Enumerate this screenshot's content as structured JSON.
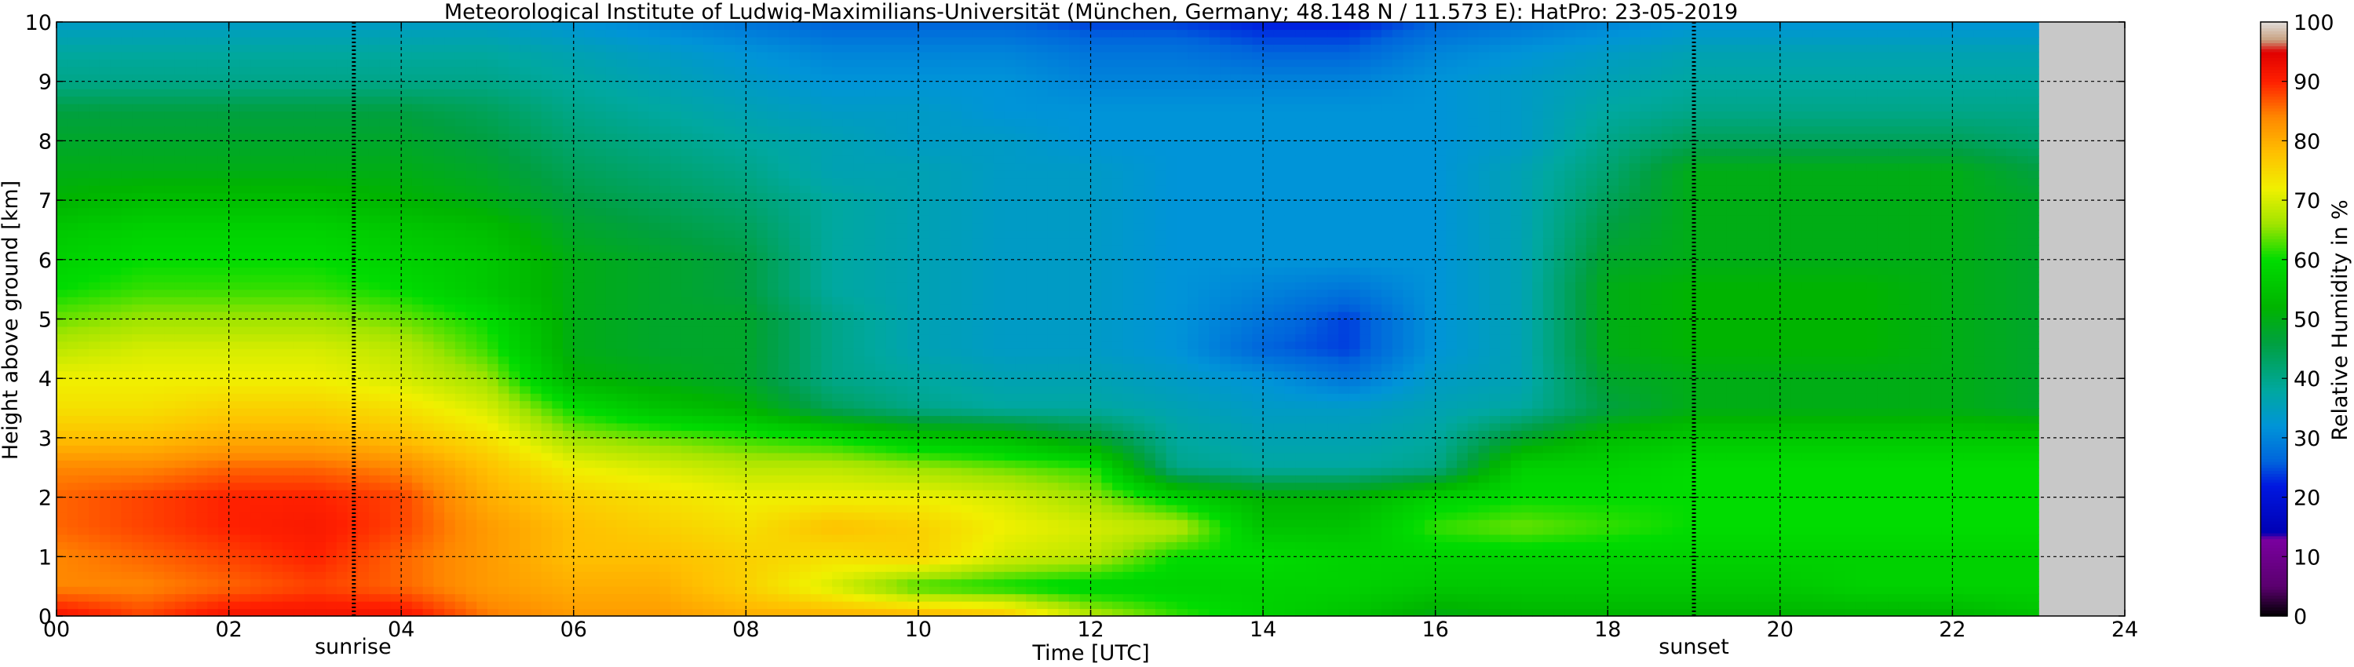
{
  "chart_data": {
    "type": "heatmap",
    "title": "Meteorological Institute of Ludwig-Maximilians-Universität (München, Germany; 48.148 N / 11.573 E):    HatPro: 23-05-2019",
    "xlabel": "Time [UTC]",
    "ylabel": "Height above ground [km]",
    "colorbar_label": "Relative Humidity in %",
    "xlim": [
      0,
      24
    ],
    "ylim": [
      0,
      10
    ],
    "xticks": [
      "00",
      "02",
      "04",
      "06",
      "08",
      "10",
      "12",
      "14",
      "16",
      "18",
      "20",
      "22",
      "24"
    ],
    "yticks": [
      "0",
      "1",
      "2",
      "3",
      "4",
      "5",
      "6",
      "7",
      "8",
      "9",
      "10"
    ],
    "colorbar_ticks": [
      "0",
      "10",
      "20",
      "30",
      "40",
      "50",
      "60",
      "70",
      "80",
      "90",
      "100"
    ],
    "colorbar_range": [
      0,
      100
    ],
    "grid": true,
    "data_end_hour": 23.0,
    "no_data_color": "#c8c8c8",
    "markers": [
      {
        "label": "sunrise",
        "hour": 3.45
      },
      {
        "label": "sunset",
        "hour": 19.0
      }
    ],
    "colormap": [
      {
        "v": 0,
        "color": "#000000"
      },
      {
        "v": 5,
        "color": "#5a006e"
      },
      {
        "v": 13,
        "color": "#7a00a0"
      },
      {
        "v": 14,
        "color": "#0000b4"
      },
      {
        "v": 22,
        "color": "#0018e0"
      },
      {
        "v": 26,
        "color": "#0064dc"
      },
      {
        "v": 32,
        "color": "#0094d8"
      },
      {
        "v": 38,
        "color": "#00a8a0"
      },
      {
        "v": 46,
        "color": "#00a040"
      },
      {
        "v": 52,
        "color": "#00b400"
      },
      {
        "v": 60,
        "color": "#00dc00"
      },
      {
        "v": 66,
        "color": "#a0e400"
      },
      {
        "v": 72,
        "color": "#f0f000"
      },
      {
        "v": 78,
        "color": "#ffc000"
      },
      {
        "v": 84,
        "color": "#ff8800"
      },
      {
        "v": 90,
        "color": "#ff2000"
      },
      {
        "v": 95,
        "color": "#e00000"
      },
      {
        "v": 97,
        "color": "#c8a080"
      },
      {
        "v": 100,
        "color": "#e0dcd8"
      }
    ],
    "times_hours": [
      0,
      1,
      2,
      3,
      4,
      5,
      6,
      7,
      8,
      9,
      10,
      11,
      12,
      13,
      14,
      15,
      16,
      17,
      18,
      19,
      20,
      21,
      22,
      23
    ],
    "heights_km": [
      0,
      0.5,
      1,
      1.5,
      2,
      2.5,
      3,
      3.5,
      4,
      4.5,
      5,
      5.5,
      6,
      6.5,
      7,
      7.5,
      8,
      8.5,
      9,
      9.5,
      10
    ],
    "rh_percent": [
      [
        92,
        88,
        92,
        92,
        92,
        85,
        82,
        82,
        80,
        80,
        80,
        78,
        68,
        62,
        58,
        55,
        50,
        52,
        52,
        52,
        52,
        52,
        52,
        55
      ],
      [
        84,
        84,
        86,
        88,
        86,
        82,
        80,
        80,
        76,
        70,
        62,
        60,
        58,
        58,
        58,
        58,
        56,
        56,
        56,
        56,
        56,
        58,
        58,
        58
      ],
      [
        84,
        86,
        88,
        90,
        86,
        82,
        78,
        78,
        76,
        74,
        76,
        70,
        68,
        60,
        60,
        58,
        58,
        58,
        58,
        58,
        58,
        58,
        58,
        58
      ],
      [
        86,
        88,
        90,
        91,
        88,
        82,
        78,
        76,
        74,
        78,
        76,
        72,
        70,
        68,
        55,
        55,
        62,
        64,
        62,
        60,
        60,
        60,
        60,
        60
      ],
      [
        86,
        88,
        90,
        90,
        88,
        80,
        76,
        74,
        72,
        72,
        72,
        70,
        66,
        58,
        52,
        52,
        58,
        60,
        60,
        60,
        60,
        60,
        60,
        60
      ],
      [
        84,
        84,
        86,
        86,
        84,
        78,
        72,
        70,
        68,
        68,
        66,
        64,
        62,
        40,
        38,
        38,
        40,
        58,
        58,
        60,
        60,
        60,
        60,
        60
      ],
      [
        78,
        78,
        80,
        80,
        78,
        74,
        66,
        64,
        62,
        60,
        56,
        54,
        48,
        38,
        36,
        36,
        38,
        48,
        54,
        56,
        56,
        56,
        56,
        56
      ],
      [
        74,
        74,
        76,
        76,
        74,
        70,
        60,
        55,
        52,
        44,
        40,
        38,
        38,
        36,
        34,
        34,
        36,
        38,
        46,
        50,
        50,
        50,
        50,
        48
      ],
      [
        72,
        72,
        72,
        72,
        70,
        66,
        52,
        50,
        48,
        40,
        38,
        36,
        36,
        34,
        32,
        28,
        34,
        36,
        48,
        50,
        50,
        50,
        50,
        48
      ],
      [
        68,
        70,
        70,
        70,
        68,
        62,
        50,
        48,
        48,
        40,
        36,
        34,
        34,
        32,
        26,
        24,
        32,
        36,
        50,
        52,
        52,
        52,
        50,
        48
      ],
      [
        64,
        66,
        66,
        66,
        64,
        60,
        50,
        48,
        48,
        40,
        36,
        34,
        34,
        32,
        28,
        24,
        32,
        36,
        50,
        52,
        52,
        52,
        50,
        48
      ],
      [
        60,
        62,
        62,
        62,
        60,
        56,
        50,
        48,
        46,
        38,
        36,
        34,
        34,
        32,
        30,
        28,
        32,
        36,
        50,
        52,
        52,
        52,
        50,
        48
      ],
      [
        58,
        60,
        60,
        60,
        58,
        56,
        50,
        48,
        46,
        38,
        36,
        34,
        34,
        32,
        32,
        32,
        32,
        36,
        48,
        50,
        50,
        50,
        50,
        48
      ],
      [
        56,
        58,
        58,
        58,
        56,
        54,
        48,
        46,
        44,
        38,
        36,
        34,
        34,
        32,
        32,
        32,
        32,
        36,
        46,
        50,
        50,
        50,
        50,
        48
      ],
      [
        52,
        54,
        54,
        54,
        52,
        50,
        46,
        44,
        42,
        38,
        36,
        34,
        34,
        32,
        32,
        32,
        32,
        36,
        44,
        50,
        50,
        50,
        50,
        48
      ],
      [
        50,
        50,
        50,
        50,
        50,
        48,
        44,
        42,
        40,
        36,
        36,
        34,
        34,
        32,
        32,
        32,
        32,
        36,
        42,
        50,
        50,
        50,
        50,
        46
      ],
      [
        48,
        48,
        48,
        48,
        48,
        46,
        42,
        40,
        38,
        36,
        34,
        34,
        32,
        32,
        32,
        32,
        32,
        34,
        40,
        44,
        44,
        44,
        44,
        42
      ],
      [
        46,
        46,
        46,
        46,
        46,
        44,
        40,
        38,
        36,
        34,
        34,
        32,
        32,
        32,
        32,
        32,
        32,
        34,
        38,
        40,
        40,
        40,
        40,
        40
      ],
      [
        40,
        40,
        40,
        40,
        40,
        40,
        38,
        36,
        34,
        32,
        32,
        32,
        30,
        30,
        30,
        30,
        32,
        34,
        36,
        38,
        38,
        38,
        38,
        38
      ],
      [
        38,
        38,
        38,
        38,
        38,
        38,
        36,
        34,
        32,
        30,
        30,
        30,
        28,
        28,
        26,
        26,
        30,
        32,
        34,
        36,
        36,
        36,
        36,
        36
      ],
      [
        34,
        34,
        34,
        34,
        34,
        34,
        32,
        30,
        28,
        26,
        26,
        26,
        24,
        24,
        22,
        22,
        26,
        28,
        30,
        32,
        32,
        32,
        32,
        32
      ]
    ]
  }
}
